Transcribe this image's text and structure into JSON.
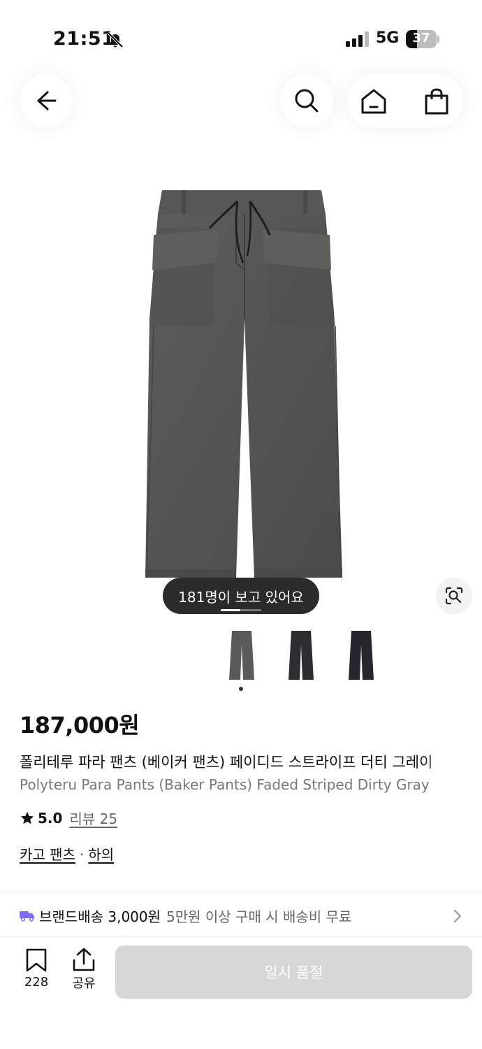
{
  "status_bar": {
    "time": "21:51",
    "network": "5G",
    "battery": "37",
    "battery_level": 0.37
  },
  "header": {
    "icons": [
      "back-arrow-icon",
      "search-icon",
      "home-icon",
      "shopping-bag-icon"
    ]
  },
  "gallery": {
    "viewers_badge": "181명이 보고 있어요",
    "thumbnail_count": 3,
    "selected_index": 0,
    "thumbnail_colors": [
      "#5a5a58",
      "#2d2d2f",
      "#26272c"
    ]
  },
  "product": {
    "price": "187,000원",
    "name_ko": "폴리테루 파라 팬츠 (베이커 팬츠) 페이디드 스트라이프 더티 그레이",
    "name_en": "Polyteru Para Pants (Baker Pants) Faded Striped Dirty Gray",
    "rating": "5.0",
    "review_link": "리뷰 25",
    "category_1": "카고 팬츠",
    "category_sep": "·",
    "category_2": "하의"
  },
  "shipping": {
    "label": "브랜드배송 3,000원",
    "desc": "5만원 이상 구매 시 배송비 무료"
  },
  "bottom_bar": {
    "bookmark_count": "228",
    "share_label": "공유",
    "soldout_label": "일시 품절"
  },
  "colors": {
    "accent_truck": "#7a6ff0",
    "disabled_button": "#d7d7d7"
  }
}
